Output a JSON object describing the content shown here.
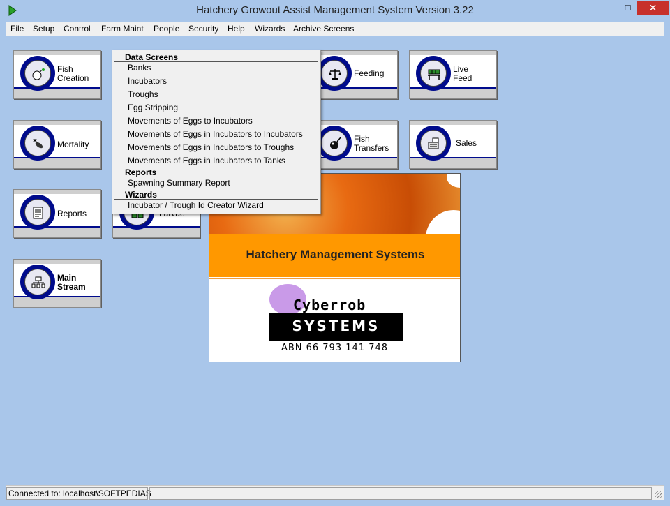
{
  "window": {
    "title": "Hatchery Growout Assist Management System Version 3.22",
    "min_glyph": "—",
    "max_glyph": "□",
    "close_glyph": "✕"
  },
  "menu": [
    "File",
    "Setup",
    "Control",
    "Farm Maint",
    "People",
    "Security",
    "Help",
    "Wizards",
    "Archive Screens"
  ],
  "tiles": [
    {
      "label": "Fish\nCreation",
      "icon": "fish-egg-icon",
      "bold": false
    },
    {
      "label": "Feeding",
      "icon": "scales-icon",
      "bold": false
    },
    {
      "label": "Live\nFeed",
      "icon": "tanks-icon",
      "bold": false
    },
    {
      "label": "Mortality",
      "icon": "dead-fish-icon",
      "bold": false
    },
    {
      "label": "Fish\nTransfers",
      "icon": "net-icon",
      "bold": false
    },
    {
      "label": "Sales",
      "icon": "cash-register-icon",
      "bold": false
    },
    {
      "label": "Reports",
      "icon": "report-icon",
      "bold": false
    },
    {
      "label": "Larvae",
      "icon": "larvae-tanks-icon",
      "bold": false
    },
    {
      "label": "Main\nStream",
      "icon": "flowchart-icon",
      "bold": true
    }
  ],
  "dropdown": {
    "data_header": "Data Screens",
    "data_items": [
      "Banks",
      "Incubators",
      "Troughs",
      "Egg Stripping",
      "Movements of Eggs to Incubators",
      "Movements of Eggs in Incubators to Incubators",
      "Movements of Eggs in Incubators to Troughs",
      "Movements of Eggs in Incubators to Tanks"
    ],
    "reports_header": "Reports",
    "reports_items": [
      "Spawning Summary Report"
    ],
    "wizards_header": "Wizards",
    "wizards_items": [
      "Incubator / Trough Id Creator Wizard"
    ]
  },
  "splash": {
    "band_text": "Hatchery Management Systems",
    "company_name": "Cyberrob",
    "company_word": "SYSTEMS",
    "abn": "ABN 66 793 141 748"
  },
  "status": {
    "connection": "Connected to: localhost\\SOFTPEDIAS"
  },
  "colors": {
    "desktop": "#a9c6ea",
    "tile_stripe": "#000b8c",
    "splash_band": "#ff9800"
  }
}
